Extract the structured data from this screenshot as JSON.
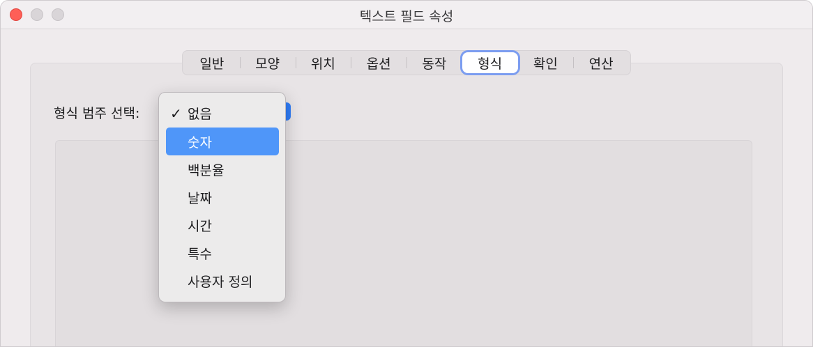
{
  "window": {
    "title": "텍스트 필드 속성"
  },
  "tabs": [
    {
      "label": "일반",
      "active": false
    },
    {
      "label": "모양",
      "active": false
    },
    {
      "label": "위치",
      "active": false
    },
    {
      "label": "옵션",
      "active": false
    },
    {
      "label": "동작",
      "active": false
    },
    {
      "label": "형식",
      "active": true
    },
    {
      "label": "확인",
      "active": false
    },
    {
      "label": "연산",
      "active": false
    }
  ],
  "format": {
    "category_label": "형식 범주 선택:",
    "selected_value": "없음"
  },
  "menu": {
    "items": [
      {
        "label": "없음",
        "checked": true
      },
      {
        "label": "숫자",
        "highlighted": true
      },
      {
        "label": "백분율"
      },
      {
        "label": "날짜"
      },
      {
        "label": "시간"
      },
      {
        "label": "특수"
      },
      {
        "label": "사용자 정의"
      }
    ],
    "check_glyph": "✓"
  },
  "colors": {
    "accent": "#4f96f9",
    "close": "#fe5f57"
  }
}
